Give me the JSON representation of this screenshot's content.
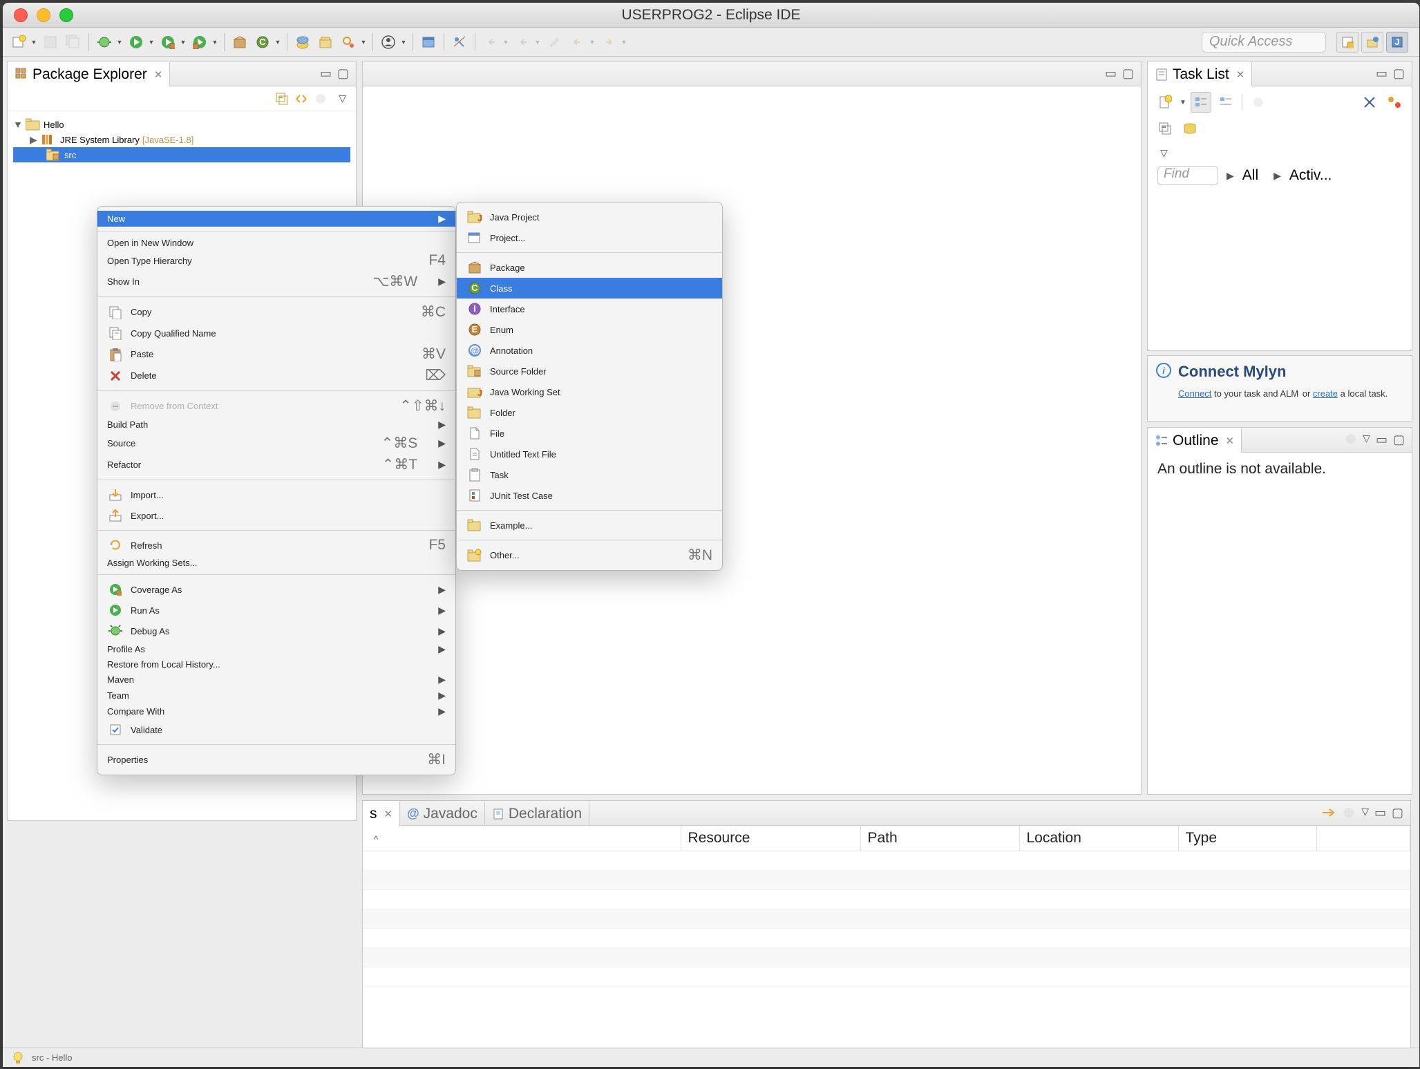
{
  "title": "USERPROG2 - Eclipse IDE",
  "quick_access": "Quick Access",
  "package_explorer": {
    "tab": "Package Explorer",
    "project": "Hello",
    "jre": "JRE System Library",
    "jre_ver": "[JavaSE-1.8]",
    "src": "src"
  },
  "ctx": {
    "new": "New",
    "open_new_window": "Open in New Window",
    "open_type_hierarchy": "Open Type Hierarchy",
    "open_type_hierarchy_key": "F4",
    "show_in": "Show In",
    "show_in_key": "⌥⌘W",
    "copy": "Copy",
    "copy_key": "⌘C",
    "copy_qualified": "Copy Qualified Name",
    "paste": "Paste",
    "paste_key": "⌘V",
    "delete": "Delete",
    "delete_key": "⌦",
    "remove_context": "Remove from Context",
    "remove_context_key": "⌃⇧⌘↓",
    "build_path": "Build Path",
    "source": "Source",
    "source_key": "⌃⌘S",
    "refactor": "Refactor",
    "refactor_key": "⌃⌘T",
    "import": "Import...",
    "export": "Export...",
    "refresh": "Refresh",
    "refresh_key": "F5",
    "assign_ws": "Assign Working Sets...",
    "coverage_as": "Coverage As",
    "run_as": "Run As",
    "debug_as": "Debug As",
    "profile_as": "Profile As",
    "restore_history": "Restore from Local History...",
    "maven": "Maven",
    "team": "Team",
    "compare_with": "Compare With",
    "validate": "Validate",
    "properties": "Properties",
    "properties_key": "⌘I"
  },
  "submenu": {
    "java_project": "Java Project",
    "project": "Project...",
    "package": "Package",
    "class": "Class",
    "interface": "Interface",
    "enum": "Enum",
    "annotation": "Annotation",
    "source_folder": "Source Folder",
    "java_ws": "Java Working Set",
    "folder": "Folder",
    "file": "File",
    "untitled": "Untitled Text File",
    "task": "Task",
    "junit": "JUnit Test Case",
    "example": "Example...",
    "other": "Other...",
    "other_key": "⌘N"
  },
  "task_list": {
    "tab": "Task List",
    "find": "Find",
    "all": "All",
    "activ": "Activ...",
    "mylyn_title": "Connect Mylyn",
    "mylyn_connect": "Connect",
    "mylyn_text1": " to your task and ALM",
    "mylyn_text2": "or ",
    "mylyn_create": "create",
    "mylyn_text3": " a local task."
  },
  "outline": {
    "tab": "Outline",
    "empty": "An outline is not available."
  },
  "problems": {
    "tab1": "s",
    "tab2": "Javadoc",
    "tab3": "Declaration",
    "cols": {
      "resource": "Resource",
      "path": "Path",
      "location": "Location",
      "type": "Type"
    }
  },
  "status": "src - Hello"
}
